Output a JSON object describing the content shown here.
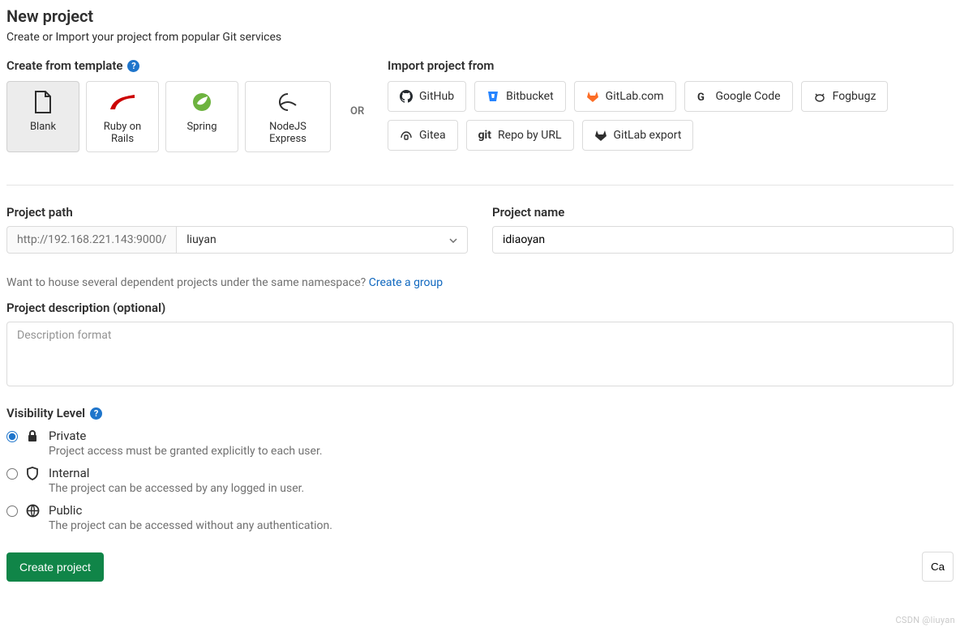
{
  "page": {
    "title": "New project",
    "subtitle": "Create or Import your project from popular Git services"
  },
  "templates": {
    "heading": "Create from template",
    "cards": [
      {
        "label": "Blank",
        "selected": true
      },
      {
        "label": "Ruby on Rails",
        "selected": false
      },
      {
        "label": "Spring",
        "selected": false
      },
      {
        "label": "NodeJS Express",
        "selected": false
      }
    ]
  },
  "divider": "OR",
  "import": {
    "heading": "Import project from",
    "sources": [
      {
        "label": "GitHub"
      },
      {
        "label": "Bitbucket"
      },
      {
        "label": "GitLab.com"
      },
      {
        "label": "Google Code"
      },
      {
        "label": "Fogbugz"
      },
      {
        "label": "Gitea"
      },
      {
        "label": "Repo by URL",
        "prefix": "git"
      },
      {
        "label": "GitLab export"
      }
    ]
  },
  "path": {
    "label": "Project path",
    "base_url": "http://192.168.221.143:9000/",
    "namespace": "liuyan"
  },
  "project_name": {
    "label": "Project name",
    "value": "idiaoyan"
  },
  "namespace_hint": {
    "text": "Want to house several dependent projects under the same namespace? ",
    "link": "Create a group"
  },
  "description": {
    "label": "Project description (optional)",
    "placeholder": "Description format"
  },
  "visibility": {
    "label": "Visibility Level",
    "options": [
      {
        "name": "Private",
        "desc": "Project access must be granted explicitly to each user.",
        "checked": true
      },
      {
        "name": "Internal",
        "desc": "The project can be accessed by any logged in user.",
        "checked": false
      },
      {
        "name": "Public",
        "desc": "The project can be accessed without any authentication.",
        "checked": false
      }
    ]
  },
  "actions": {
    "submit": "Create project",
    "cancel": "Ca"
  },
  "watermark": "CSDN @liuyan"
}
